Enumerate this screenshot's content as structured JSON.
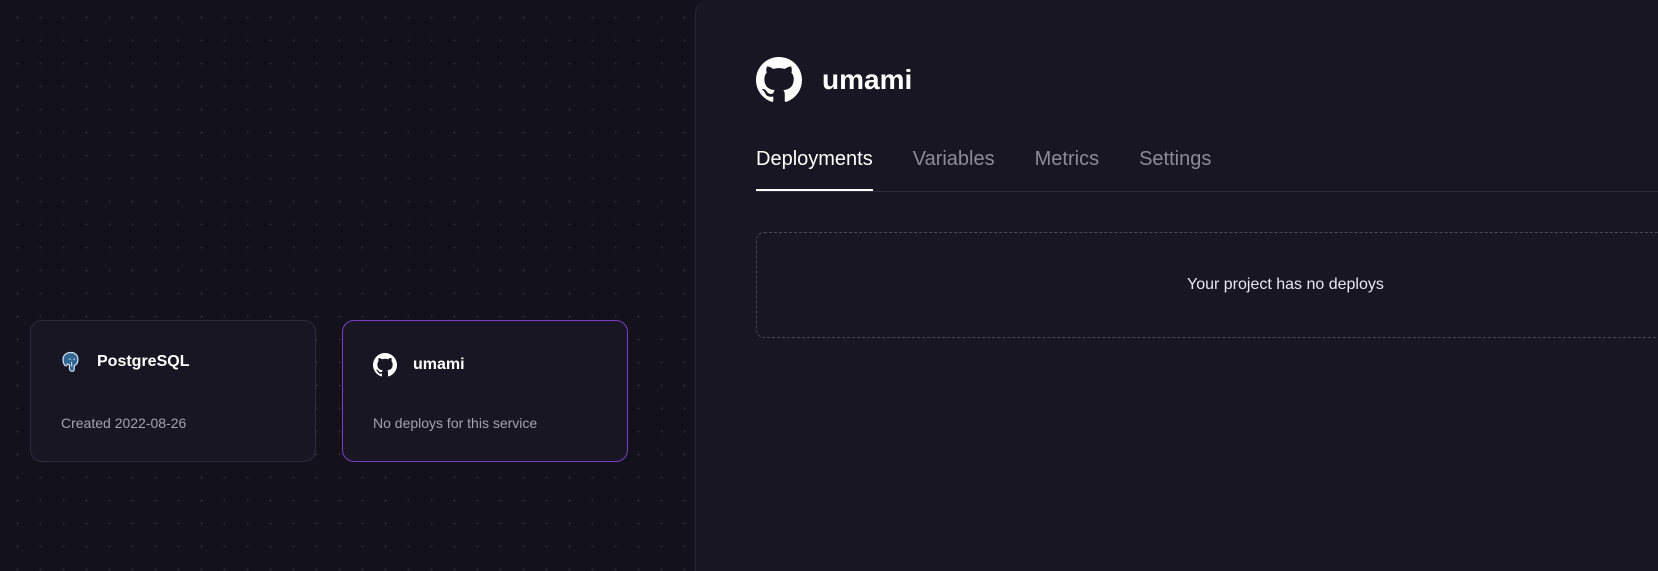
{
  "canvas": {
    "services": [
      {
        "id": "postgres",
        "title": "PostgreSQL",
        "subtitle": "Created 2022-08-26",
        "icon": "postgres-elephant-icon",
        "selected": false
      },
      {
        "id": "umami",
        "title": "umami",
        "subtitle": "No deploys for this service",
        "icon": "github-icon",
        "selected": true
      }
    ]
  },
  "panel": {
    "title": "umami",
    "icon": "github-icon",
    "tabs": [
      {
        "label": "Deployments",
        "active": true
      },
      {
        "label": "Variables",
        "active": false
      },
      {
        "label": "Metrics",
        "active": false
      },
      {
        "label": "Settings",
        "active": false
      }
    ],
    "empty_message": "Your project has no deploys"
  },
  "colors": {
    "background": "#13111c",
    "card_background": "#181622",
    "selected_border": "#7b3fc4",
    "muted_text": "#8d8b98"
  }
}
